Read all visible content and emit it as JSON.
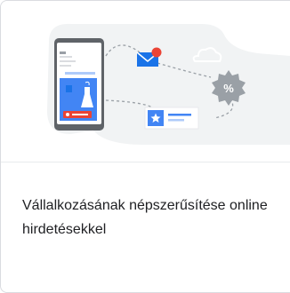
{
  "card": {
    "title": "Vállalkozásának népszerűsítése online hirdetésekkel"
  },
  "colors": {
    "background_blob": "#f1f3f4",
    "phone_frame": "#5f6368",
    "accent_blue": "#4285f4",
    "accent_red": "#ea4335",
    "gear": "#9aa0a6",
    "text": "#202124"
  },
  "icons": [
    "phone-illustration",
    "shopping-bag-icon",
    "dress-icon",
    "mail-icon",
    "discount-gear-icon",
    "cloud-icon",
    "ad-listing-icon",
    "star-icon"
  ]
}
